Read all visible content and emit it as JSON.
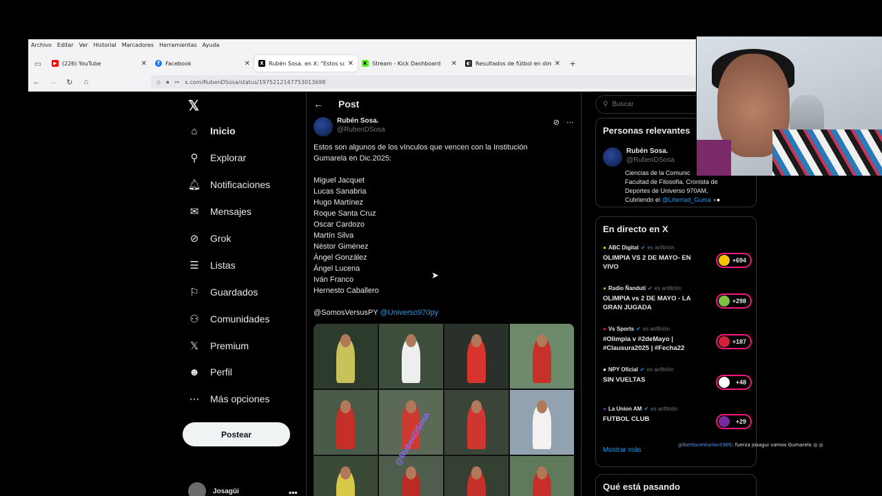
{
  "browser": {
    "menu": [
      "Archivo",
      "Editar",
      "Ver",
      "Historial",
      "Marcadores",
      "Herramientas",
      "Ayuda"
    ],
    "tabs": [
      {
        "title": "(226) YouTube",
        "favicon": "youtube-icon",
        "color": "#ff0000"
      },
      {
        "title": "Facebook",
        "favicon": "facebook-icon",
        "color": "#1877f2"
      },
      {
        "title": "Rubén Sosa. en X: \"Estos son al",
        "favicon": "x-icon",
        "color": "#000000"
      },
      {
        "title": "Stream - Kick Dashboard",
        "favicon": "kick-icon",
        "color": "#53fc18"
      },
      {
        "title": "Resultados de fútbol en directo",
        "favicon": "flashscore-icon",
        "color": "#222222"
      }
    ],
    "url": "x.com/RubenDSosa/status/1975212147753013698"
  },
  "nav": {
    "items": [
      {
        "label": "Inicio",
        "icon": "home-icon",
        "glyph": "⌂"
      },
      {
        "label": "Explorar",
        "icon": "search-icon",
        "glyph": "⚲"
      },
      {
        "label": "Notificaciones",
        "icon": "bell-icon",
        "glyph": "♫"
      },
      {
        "label": "Mensajes",
        "icon": "mail-icon",
        "glyph": "✉"
      },
      {
        "label": "Grok",
        "icon": "grok-icon",
        "glyph": "⊘"
      },
      {
        "label": "Listas",
        "icon": "list-icon",
        "glyph": "☰"
      },
      {
        "label": "Guardados",
        "icon": "bookmark-icon",
        "glyph": "⚑"
      },
      {
        "label": "Comunidades",
        "icon": "communities-icon",
        "glyph": "☺"
      },
      {
        "label": "Premium",
        "icon": "x-premium-icon",
        "glyph": "X"
      },
      {
        "label": "Perfil",
        "icon": "profile-icon",
        "glyph": "☻"
      },
      {
        "label": "Más opciones",
        "icon": "more-icon",
        "glyph": "⋯"
      }
    ],
    "post_button": "Postear",
    "account_name": "Josagüi"
  },
  "post": {
    "header": "Post",
    "author_name": "Rubén Sosa.",
    "author_handle": "@RubenDSosa",
    "intro_line1": "Estos son algunos de los vínculos que vencen con la Institución",
    "intro_line2": "Gumarela en Dic.2025:",
    "players": [
      "Miguel Jacquet",
      "Lucas Sanabria",
      "Hugo Martínez",
      "Roque Santa Cruz",
      "Oscar Cardozo",
      "Martín Silva",
      "Néstor Giménez",
      "Ángel González",
      "Ángel Lucena",
      "Iván Franco",
      "Hernesto Caballero"
    ],
    "mention1": "@SomosVersusPY",
    "mention2": "@Universo970py",
    "watermark": "@RubenDSosa"
  },
  "sidebar": {
    "search_placeholder": "Buscar",
    "relevant_title": "Personas relevantes",
    "relevant_name": "Rubén Sosa.",
    "relevant_handle": "@RubenDSosa",
    "relevant_bio_1": "Ciencias de la Comunic",
    "relevant_bio_2": "Facultad de Filosofía. Cronista de",
    "relevant_bio_3": "Deportes de Universo 970AM,",
    "relevant_bio_4": "Cubriendo el",
    "relevant_bio_mention": "@Libertad_Guma",
    "live_title": "En directo en X",
    "live": [
      {
        "host": "ABC Digital",
        "role": "es anfitrión",
        "title": "OLIMPIA VS 2 DE MAYO- EN VIVO",
        "count": "+694",
        "dot": "#f5c400"
      },
      {
        "host": "Radio Ñandutí",
        "role": "es anfitrión",
        "title": "OLIMPIA vs 2 DE MAYO - LA GRAN JUGADA",
        "count": "+298",
        "dot": "#7cc242"
      },
      {
        "host": "Vs Sports",
        "role": "es anfitrión",
        "title": "#Olimpia v #2deMayo | #Clausura2025 | #Fecha22",
        "count": "+187",
        "dot": "#d0203a"
      },
      {
        "host": "NPY Oficial",
        "role": "es anfitrión",
        "title": "SIN VUELTAS",
        "count": "+48",
        "dot": "#ffffff"
      },
      {
        "host": "La Union AM",
        "role": "es anfitrión",
        "title": "FUTBOL CLUB",
        "count": "+29",
        "dot": "#7a2a9c"
      }
    ],
    "show_more": "Mostrar más",
    "trending_title": "Qué está pasando"
  },
  "chat": {
    "user": "gilbertocenturion1905",
    "message": ": fuerza josagui vamos Gumarelo"
  }
}
